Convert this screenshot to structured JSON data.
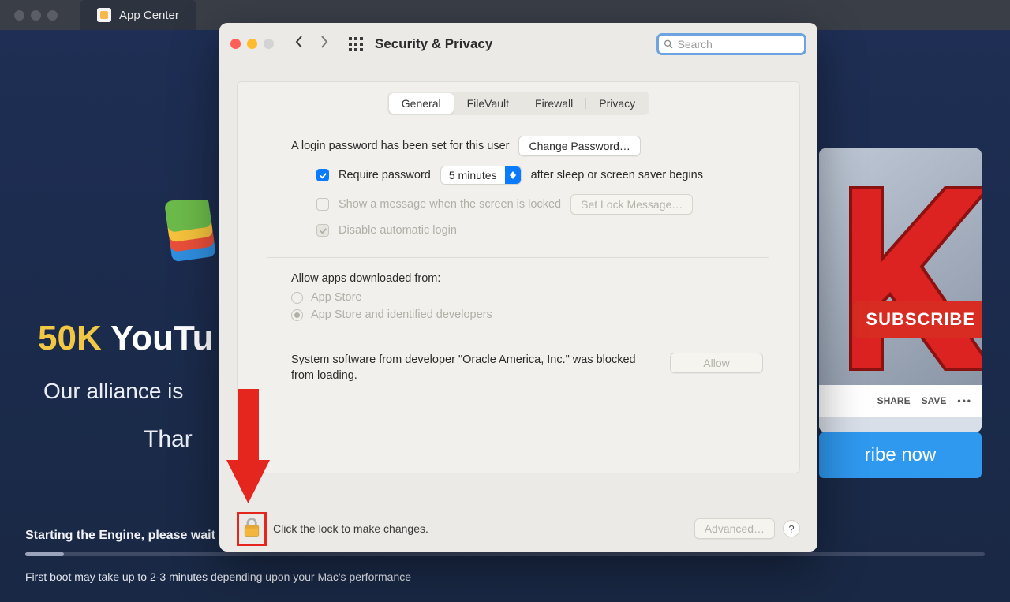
{
  "background": {
    "tab_title": "App Center",
    "headline_accent": "50K",
    "headline_rest": " YouTu",
    "subhead": "Our alliance is",
    "subhead2": "Thar",
    "subscribe_label": "SUBSCRIBE",
    "share_label": "SHARE",
    "save_label": "SAVE",
    "cta_label": "ribe now",
    "status_line": "Starting the Engine, please wait",
    "hint_line": "First boot may take up to 2-3 minutes depending upon your Mac's performance"
  },
  "prefs": {
    "title": "Security & Privacy",
    "search_placeholder": "Search",
    "tabs": {
      "general": "General",
      "filevault": "FileVault",
      "firewall": "Firewall",
      "privacy": "Privacy"
    },
    "login_pw_text": "A login password has been set for this user",
    "change_pw_btn": "Change Password…",
    "require_pw_label": "Require password",
    "require_pw_delay": "5 minutes",
    "require_pw_after": "after sleep or screen saver begins",
    "show_msg_label": "Show a message when the screen is locked",
    "set_lock_btn": "Set Lock Message…",
    "disable_auto_label": "Disable automatic login",
    "allow_apps_label": "Allow apps downloaded from:",
    "opt_appstore": "App Store",
    "opt_identified": "App Store and identified developers",
    "blocked_text": "System software from developer \"Oracle America, Inc.\" was blocked from loading.",
    "allow_btn": "Allow",
    "lock_text": "Click the lock to make changes.",
    "advanced_btn": "Advanced…",
    "help_label": "?"
  }
}
